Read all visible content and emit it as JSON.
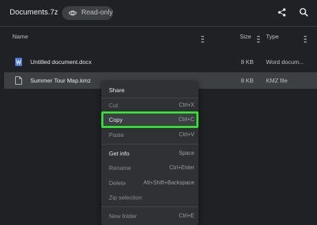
{
  "window": {
    "title": "Documents.7z",
    "badge_label": "Read-only",
    "badge_icon": "eye-icon",
    "actions": [
      "share-icon",
      "search-icon"
    ]
  },
  "table": {
    "headers": {
      "name": "Name",
      "size": "Size",
      "type": "Type"
    },
    "rows": [
      {
        "icon": "word-document-icon",
        "name": "Untitled document.docx",
        "size": "8 KB",
        "type": "Word docum..."
      },
      {
        "icon": "file-icon",
        "name": "Summer Tour Map.kmz",
        "size": "8 KB",
        "type": "KMZ file",
        "selected": true
      }
    ]
  },
  "context_menu": {
    "items": [
      {
        "label": "Share",
        "shortcut": "",
        "enabled": true
      },
      {
        "label": "Cut",
        "shortcut": "Ctrl+X",
        "enabled": false
      },
      {
        "label": "Copy",
        "shortcut": "Ctrl+C",
        "enabled": true,
        "highlighted": true
      },
      {
        "label": "Paste",
        "shortcut": "Ctrl+V",
        "enabled": false
      },
      {
        "label": "Get info",
        "shortcut": "Space",
        "enabled": true
      },
      {
        "label": "Rename",
        "shortcut": "Ctrl+Enter",
        "enabled": false
      },
      {
        "label": "Delete",
        "shortcut": "Alt+Shift+Backspace",
        "enabled": false
      },
      {
        "label": "Zip selection",
        "shortcut": "",
        "enabled": false
      },
      {
        "label": "New folder",
        "shortcut": "Ctrl+E",
        "enabled": false
      }
    ]
  },
  "colors": {
    "background": "#202124",
    "selected_row": "#3c4043",
    "menu_background": "#303134",
    "annotation_highlight": "#2ee62e",
    "word_icon": "#4a7ee0"
  }
}
